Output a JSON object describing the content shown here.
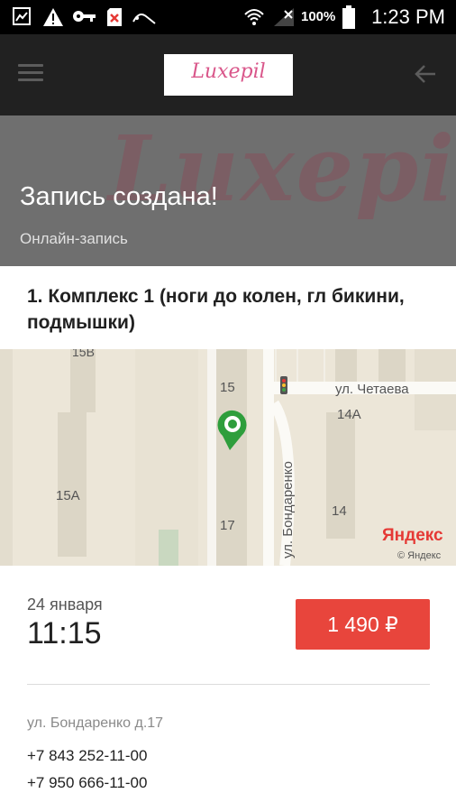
{
  "status_bar": {
    "battery": "100%",
    "time": "1:23 PM"
  },
  "toolbar": {
    "logo": "Luxepil"
  },
  "header": {
    "watermark": "Luxepil",
    "title": "Запись создана!",
    "subtitle": "Онлайн-запись"
  },
  "service": {
    "title": "1. Комплекс 1 (ноги до колен, гл бикини, подмышки)"
  },
  "map": {
    "labels": {
      "b15b": "15В",
      "b15": "15",
      "b14a": "14А",
      "b15a": "15А",
      "b17": "17",
      "b14": "14",
      "street_chetaeva": "ул. Четаева",
      "street_bondarenko": "ул. Бондаренко"
    },
    "brand": "Яндекс",
    "copyright": "© Яндекс"
  },
  "booking": {
    "date": "24 января",
    "time": "11:15",
    "price": "1 490 ₽",
    "address": "ул. Бондаренко д.17",
    "phone1": "+7 843 252-11-00",
    "phone2": "+7 950 666-11-00"
  }
}
